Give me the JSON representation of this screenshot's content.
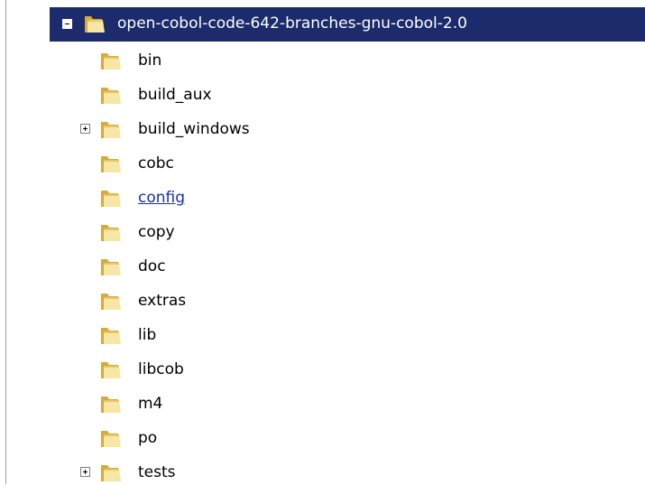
{
  "tree": {
    "root": {
      "label": "open-cobol-code-642-branches-gnu-cobol-2.0",
      "expanded": true,
      "selected": true,
      "icon": "folder-icon"
    },
    "children": [
      {
        "label": "bin",
        "expandable": false,
        "icon": "folder-icon"
      },
      {
        "label": "build_aux",
        "expandable": false,
        "icon": "folder-icon"
      },
      {
        "label": "build_windows",
        "expandable": true,
        "expanded": false,
        "icon": "folder-icon"
      },
      {
        "label": "cobc",
        "expandable": false,
        "icon": "folder-icon"
      },
      {
        "label": "config",
        "expandable": false,
        "hovered": true,
        "icon": "folder-icon"
      },
      {
        "label": "copy",
        "expandable": false,
        "icon": "folder-icon"
      },
      {
        "label": "doc",
        "expandable": false,
        "icon": "folder-icon"
      },
      {
        "label": "extras",
        "expandable": false,
        "icon": "folder-icon"
      },
      {
        "label": "lib",
        "expandable": false,
        "icon": "folder-icon"
      },
      {
        "label": "libcob",
        "expandable": false,
        "icon": "folder-icon"
      },
      {
        "label": "m4",
        "expandable": false,
        "icon": "folder-icon"
      },
      {
        "label": "po",
        "expandable": false,
        "icon": "folder-icon"
      },
      {
        "label": "tests",
        "expandable": true,
        "expanded": false,
        "icon": "folder-icon"
      }
    ]
  },
  "colors": {
    "selection_bg": "#1b2b6b",
    "selection_text": "#ffffff",
    "link_text": "#1a2faa",
    "folder_light": "#f7e7a6",
    "folder_dark": "#d9a93a"
  }
}
